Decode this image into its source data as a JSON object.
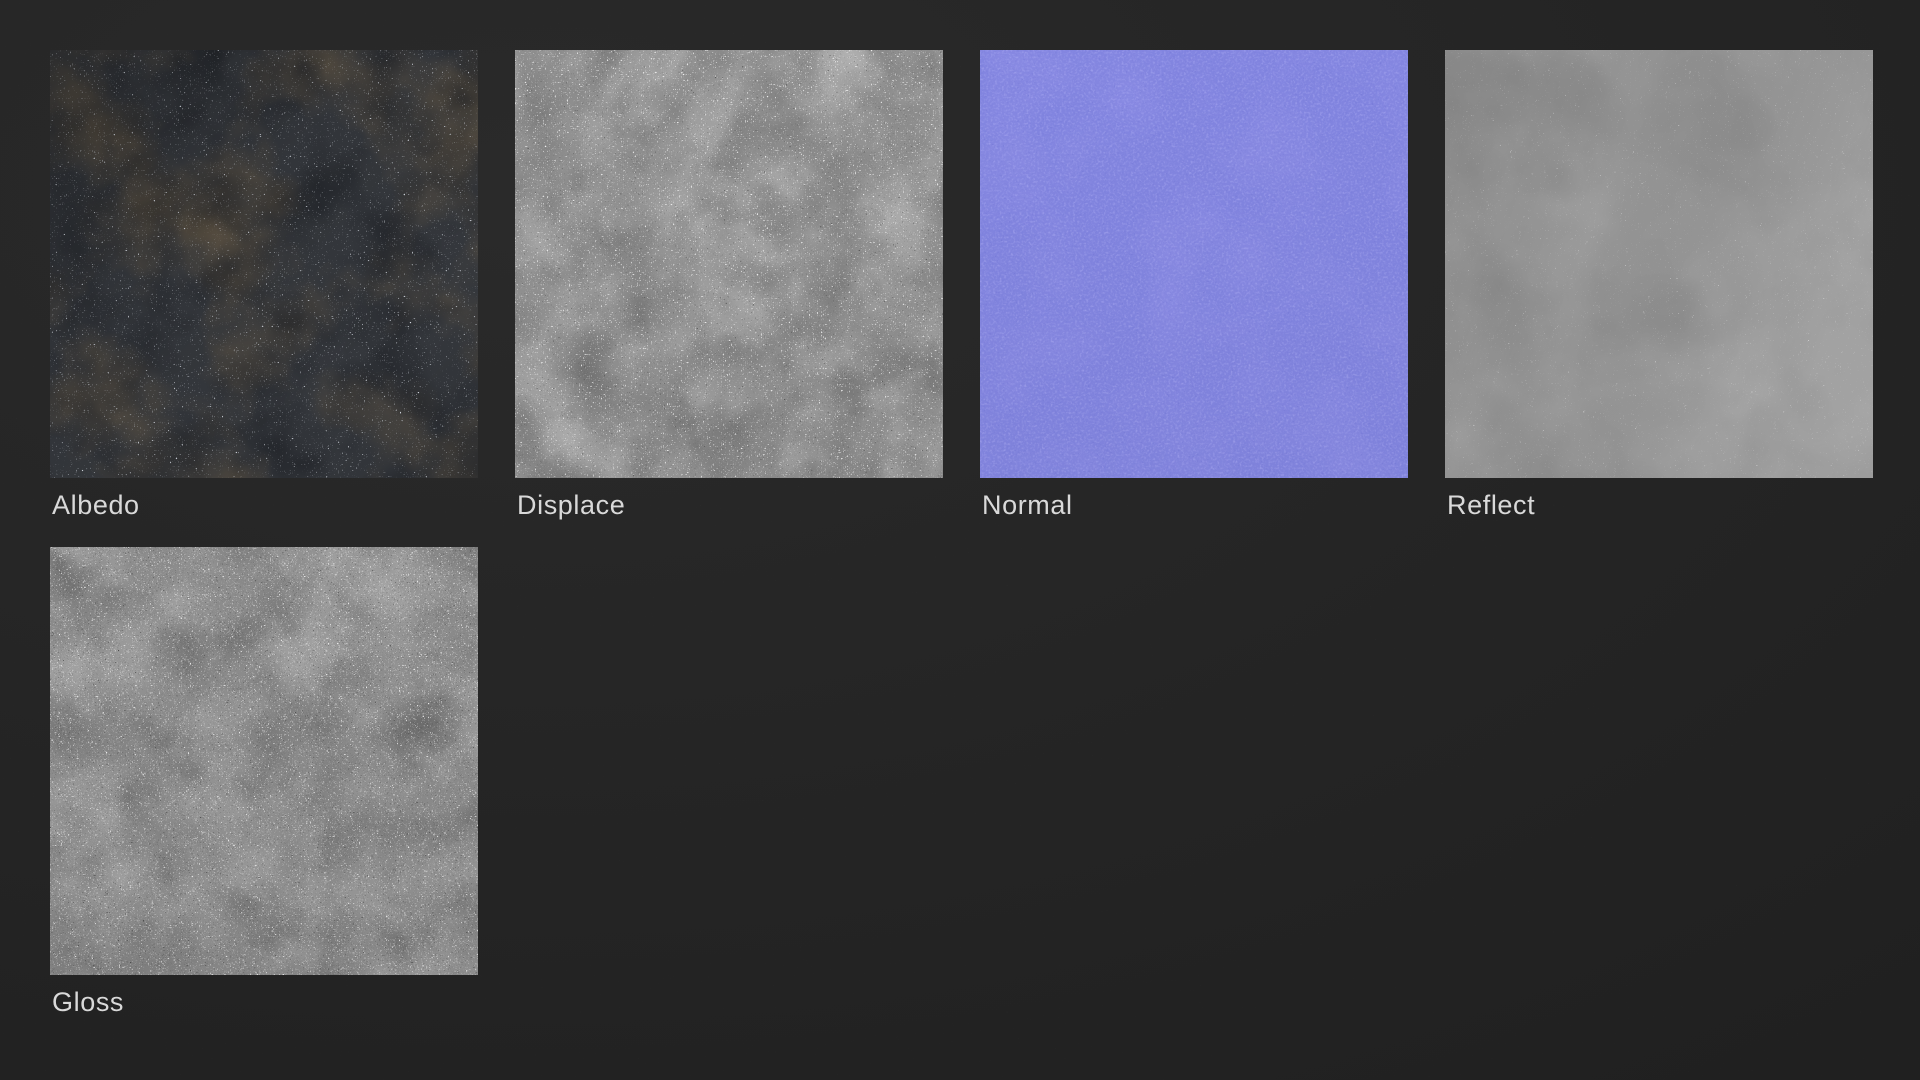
{
  "page": {
    "background_color": "#232323",
    "label_color": "#d9d9d9"
  },
  "texture_maps": [
    {
      "label": "Albedo",
      "type": "albedo",
      "base_color": "#34373c"
    },
    {
      "label": "Displace",
      "type": "displace",
      "base_color": "#909090"
    },
    {
      "label": "Normal",
      "type": "normal",
      "base_color": "#8487e4"
    },
    {
      "label": "Reflect",
      "type": "reflect",
      "base_color": "#959595"
    },
    {
      "label": "Gloss",
      "type": "gloss",
      "base_color": "#8a8a8a"
    }
  ]
}
